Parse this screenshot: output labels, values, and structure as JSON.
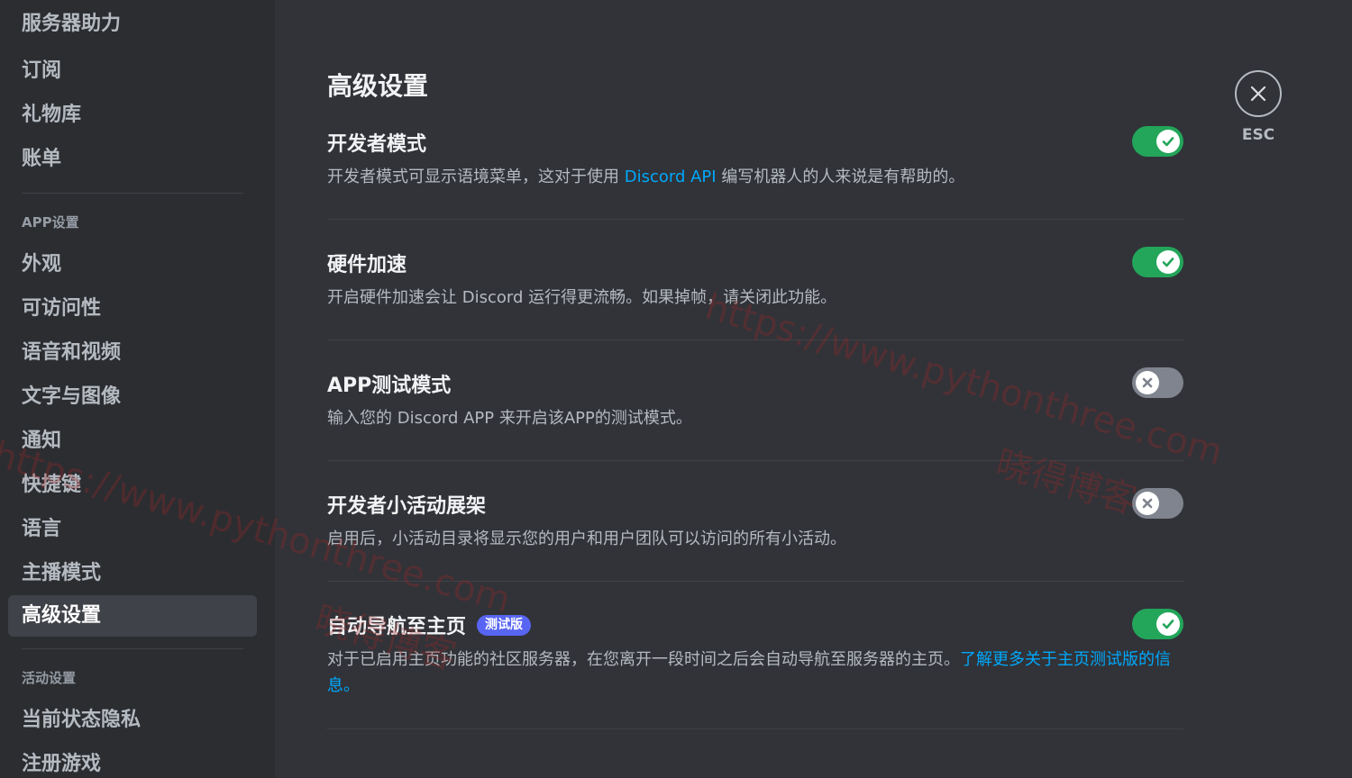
{
  "sidebar": {
    "top_items": [
      "服务器助力",
      "订阅",
      "礼物库",
      "账单"
    ],
    "app_settings_header": "APP设置",
    "app_items": [
      "外观",
      "可访问性",
      "语音和视频",
      "文字与图像",
      "通知",
      "快捷键",
      "语言",
      "主播模式",
      "高级设置"
    ],
    "selected_item": "高级设置",
    "activity_header": "活动设置",
    "activity_items": [
      "当前状态隐私",
      "注册游戏"
    ]
  },
  "main": {
    "title": "高级设置",
    "settings": [
      {
        "title": "开发者模式",
        "desc_before": "开发者模式可显示语境菜单，这对于使用 ",
        "desc_link": "Discord API",
        "desc_after": " 编写机器人的人来说是有帮助的。",
        "enabled": true
      },
      {
        "title": "硬件加速",
        "desc": "开启硬件加速会让 Discord 运行得更流畅。如果掉帧，请关闭此功能。",
        "enabled": true
      },
      {
        "title": "APP测试模式",
        "desc": "输入您的 Discord APP 来开启该APP的测试模式。",
        "enabled": false
      },
      {
        "title": "开发者小活动展架",
        "desc": "启用后，小活动目录将显示您的用户和用户团队可以访问的所有小活动。",
        "enabled": false
      },
      {
        "title": "自动导航至主页",
        "badge": "测试版",
        "desc_before": "对于已启用主页功能的社区服务器，在您离开一段时间之后会自动导航至服务器的主页。",
        "desc_link": "了解更多关于主页测试版的信息。",
        "enabled": true
      }
    ]
  },
  "close": {
    "label": "ESC"
  },
  "watermark": {
    "url": "https://www.pythonthree.com",
    "name": "晓得博客"
  },
  "colors": {
    "toggle_on": "#23a55a",
    "toggle_off": "#80848e",
    "link": "#00a8fc",
    "badge": "#5865f2"
  }
}
